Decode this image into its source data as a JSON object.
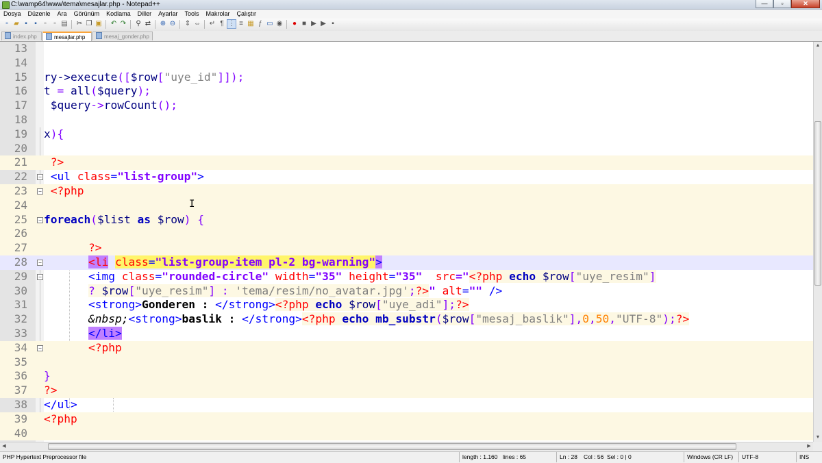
{
  "window": {
    "title": "C:\\wamp64\\www\\tema\\mesajlar.php - Notepad++"
  },
  "menu": [
    "Dosya",
    "Düzenle",
    "Ara",
    "Görünüm",
    "Kodlama",
    "Diller",
    "Ayarlar",
    "Tools",
    "Makrolar",
    "Çalıştır"
  ],
  "tabs": [
    {
      "label": "index.php",
      "active": false
    },
    {
      "label": "mesajlar.php",
      "active": true
    },
    {
      "label": "mesaj_gonder.php",
      "active": false
    }
  ],
  "editor": {
    "lines": [
      "13",
      "14",
      "15",
      "16",
      "17",
      "18",
      "19",
      "20",
      "21",
      "22",
      "23",
      "24",
      "25",
      "26",
      "27",
      "28",
      "29",
      "30",
      "31",
      "32",
      "33",
      "34",
      "35",
      "36",
      "37",
      "38",
      "39",
      "40"
    ],
    "current_line": "28"
  },
  "statusbar": {
    "file_type": "PHP Hypertext Preprocessor file",
    "length": "length : 1.160",
    "lines": "lines : 65",
    "ln": "Ln : 28",
    "col": "Col : 56",
    "sel": "Sel : 0 | 0",
    "eol": "Windows (CR LF)",
    "encoding": "UTF-8",
    "mode": "INS"
  },
  "code": {
    "l15a": "ry->",
    "l15b": "execute",
    "l15c": "([",
    "l15d": "$row",
    "l15e": "[",
    "l15f": "\"uye_id\"",
    "l15g": "]]);",
    "l16a": "t ",
    "l16b": "= ",
    "l16c": "all",
    "l16d": "(",
    "l16e": "$query",
    "l16f": ");",
    "l17a": " $query",
    "l17b": "->",
    "l17c": "rowCount",
    "l17d": "();",
    "l19a": "x",
    "l19b": "){",
    "l21a": " ?>",
    "l22a": " <ul ",
    "l22b": "class",
    "l22c": "=",
    "l22d": "\"list-group\"",
    "l22e": ">",
    "l23a": " <?php",
    "l25a": "foreach",
    "l25b": "(",
    "l25c": "$list ",
    "l25d": "as ",
    "l25e": "$row",
    "l25f": ") {",
    "l27a": "?>",
    "l28a": "<li",
    "l28b": "class",
    "l28c": "=",
    "l28d": "\"list-group-item pl-2 bg-warning\"",
    "l28e": ">",
    "l29a": "<img ",
    "l29b": "class",
    "l29c": "=",
    "l29d": "\"rounded-circle\" ",
    "l29e": "width",
    "l29f": "=",
    "l29g": "\"35\" ",
    "l29h": "height",
    "l29i": "=",
    "l29j": "\"35\"  ",
    "l29k": "src",
    "l29l": "=\"",
    "l29m": "<?php ",
    "l29n": "echo ",
    "l29o": "$row",
    "l29p": "[",
    "l29q": "\"uye_resim\"",
    "l29r": "]",
    "l30a": "? ",
    "l30b": "$row",
    "l30c": "[",
    "l30d": "\"uye_resim\"",
    "l30e": "] : ",
    "l30f": "'tema/resim/no_avatar.jpg'",
    "l30g": ";",
    "l30h": "?>",
    "l30i": "\" ",
    "l30j": "alt",
    "l30k": "=",
    "l30l": "\"\" ",
    "l30m": "/>",
    "l31a": "<strong>",
    "l31b": "Gonderen : ",
    "l31c": "</strong>",
    "l31d": "<?php ",
    "l31e": "echo ",
    "l31f": "$row",
    "l31g": "[",
    "l31h": "\"uye_adi\"",
    "l31i": "];",
    "l31j": "?>",
    "l32a": "&nbsp;",
    "l32b": "<strong>",
    "l32c": "baslik : ",
    "l32d": "</strong>",
    "l32e": "<?php ",
    "l32f": "echo ",
    "l32g": "mb_substr",
    "l32h": "(",
    "l32i": "$row",
    "l32j": "[",
    "l32k": "\"mesaj_baslik\"",
    "l32l": "],",
    "l32m": "0",
    "l32n": ",",
    "l32o": "50",
    "l32p": ",",
    "l32q": "\"UTF-8\"",
    "l32r": ");",
    "l32s": "?>",
    "l33a": "</li>",
    "l34a": "<?php",
    "l36a": "}",
    "l37a": "?>",
    "l38a": "</ul>",
    "l39a": "<?php"
  }
}
